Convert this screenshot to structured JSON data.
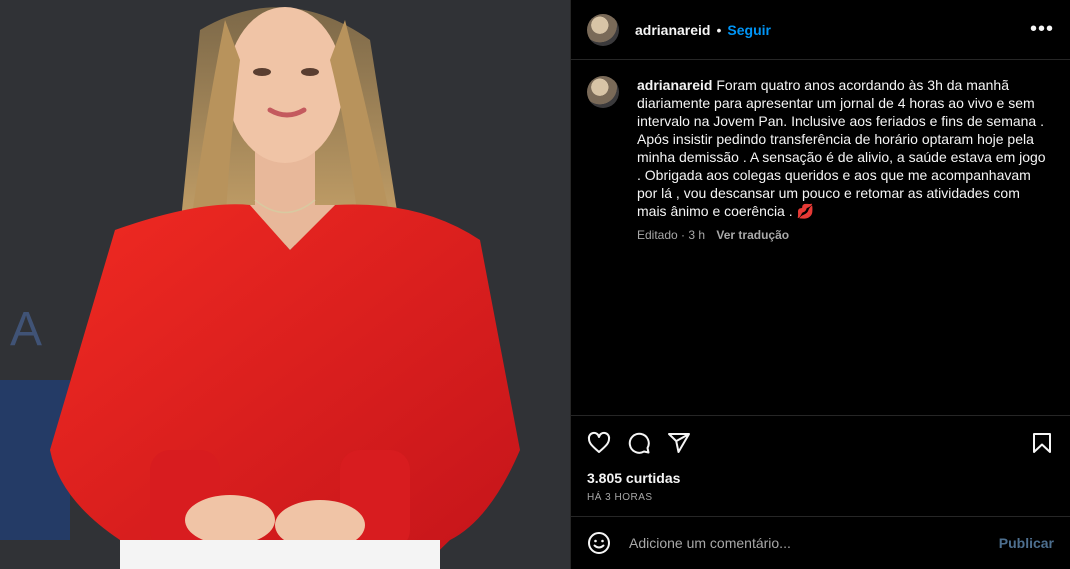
{
  "header": {
    "username": "adrianareid",
    "separator": "•",
    "follow_label": "Seguir",
    "more_label": "•••"
  },
  "caption": {
    "username": "adrianareid",
    "text": "Foram quatro anos acordando às 3h da manhã diariamente para apresentar um jornal de 4 horas ao vivo e sem intervalo na Jovem Pan. Inclusive aos feriados e fins de semana . Após insistir pedindo transferência de horário optaram hoje pela minha demissão . A sensação é de alivio, a saúde estava em jogo . Obrigada aos colegas queridos e aos que me acompanhavam por lá , vou descansar um pouco e retomar as atividades com mais ânimo e coerência . 💋",
    "edited": "Editado · 3 h",
    "translate_label": "Ver tradução"
  },
  "stats": {
    "likes": "3.805 curtidas",
    "time_ago": "HÁ 3 HORAS"
  },
  "comment": {
    "placeholder": "Adicione um comentário...",
    "publish_label": "Publicar"
  },
  "icons": [
    "heart-icon",
    "comment-icon",
    "share-icon",
    "bookmark-icon",
    "emoji-icon",
    "more-icon"
  ],
  "colors": {
    "background": "#000000",
    "link_blue": "#0095f6",
    "muted_text": "#a8a8a8",
    "divider": "#262626",
    "publish_disabled": "#4d6f8f",
    "blouse_red": "#e0201e"
  }
}
